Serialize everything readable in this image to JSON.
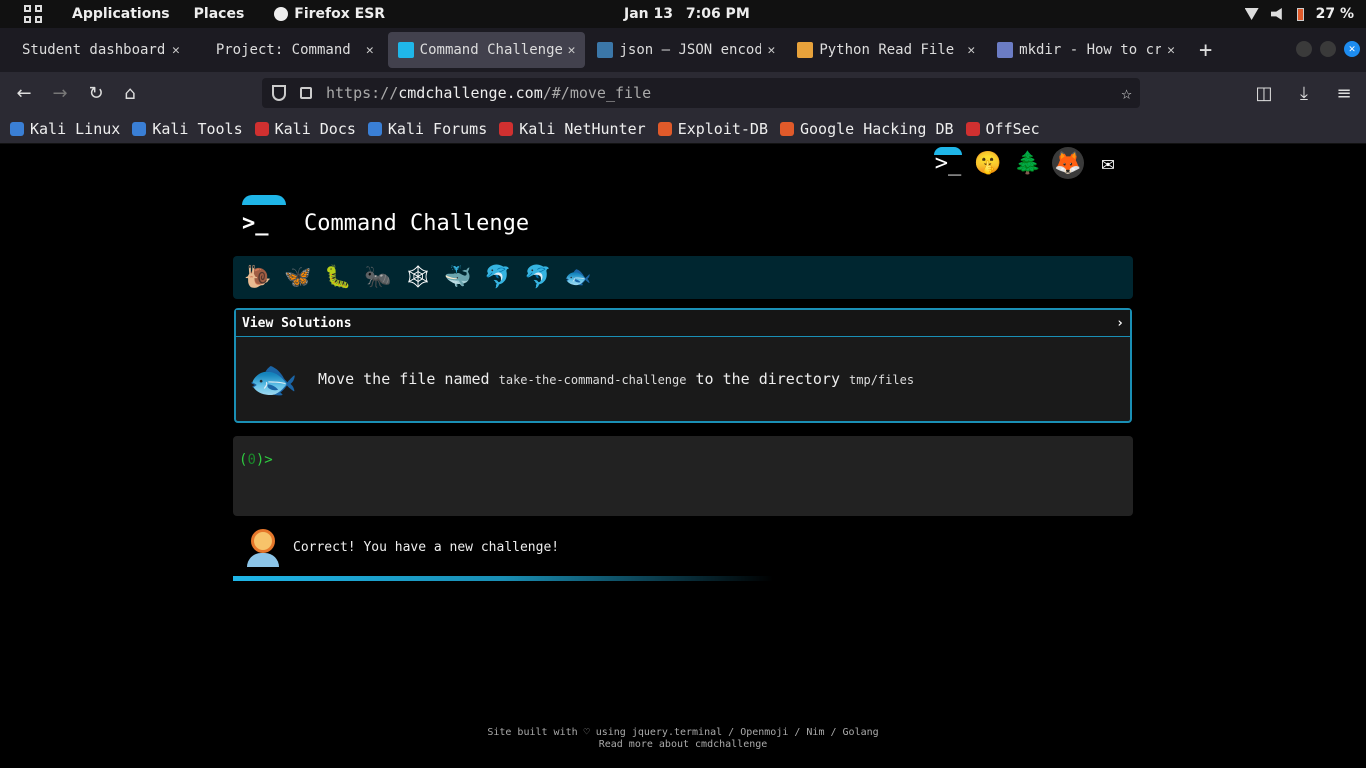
{
  "system": {
    "applications": "Applications",
    "places": "Places",
    "browser": "Firefox ESR",
    "date": "Jan 13",
    "time": "7:06 PM",
    "battery": "27 %"
  },
  "tabs": [
    {
      "title": "Student dashboard",
      "favicon_color": "#2b2a33",
      "active": false
    },
    {
      "title": "Project: Command Challenge",
      "favicon_color": "#2b2a33",
      "active": false
    },
    {
      "title": "Command Challenge",
      "favicon_color": "#1fb6e8",
      "active": true
    },
    {
      "title": "json — JSON encoder",
      "favicon_color": "#3b77a8",
      "active": false
    },
    {
      "title": "Python Read File",
      "favicon_color": "#e8a23b",
      "active": false
    },
    {
      "title": "mkdir - How to create",
      "favicon_color": "#6b7cc4",
      "active": false
    }
  ],
  "nav": {
    "url_scheme": "https://",
    "url_host": "cmdchallenge.com",
    "url_path": "/#/move_file"
  },
  "bookmarks": [
    {
      "label": "Kali Linux",
      "color": "#3a7fd5"
    },
    {
      "label": "Kali Tools",
      "color": "#3a7fd5"
    },
    {
      "label": "Kali Docs",
      "color": "#d03030"
    },
    {
      "label": "Kali Forums",
      "color": "#3a7fd5"
    },
    {
      "label": "Kali NetHunter",
      "color": "#d03030"
    },
    {
      "label": "Exploit-DB",
      "color": "#e05a2a"
    },
    {
      "label": "Google Hacking DB",
      "color": "#e05a2a"
    },
    {
      "label": "OffSec",
      "color": "#d03030"
    }
  ],
  "page": {
    "site_title": "Command Challenge",
    "levels": [
      "🐌",
      "🦋",
      "🐛",
      "🐜",
      "🕸",
      "🐳",
      "🐬",
      "🐬",
      "🐟"
    ],
    "view_solutions": "View Solutions",
    "expand_icon": "›",
    "challenge_prefix": "Move the file named ",
    "challenge_file": "take-the-command-challenge",
    "challenge_middle": " to the directory ",
    "challenge_dir": "tmp/files",
    "prompt_open": "(",
    "prompt_count": "0",
    "prompt_close": ")>",
    "status_message": "Correct! You have a new challenge!",
    "progress_fraction": 0.6,
    "footer_line1": "Site built with ♡ using jquery.terminal / Openmoji / Nim / Golang",
    "footer_line2": "Read more about cmdchallenge"
  },
  "colors": {
    "accent": "#1fb6e8",
    "prompt_green": "#2ecc40",
    "levels_bg": "#002630"
  }
}
